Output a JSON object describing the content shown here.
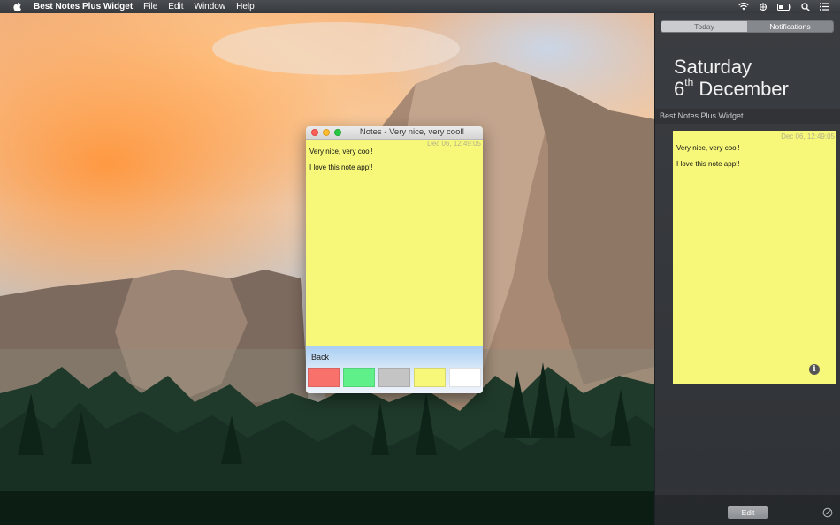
{
  "menubar": {
    "apple_icon": "apple-logo-icon",
    "app_name": "Best Notes Plus Widget",
    "menus": [
      "File",
      "Edit",
      "Window",
      "Help"
    ],
    "status_icons": [
      "wifi-icon",
      "network-icon",
      "battery-icon",
      "spotlight-search-icon",
      "notification-center-icon"
    ]
  },
  "note_window": {
    "title": "Notes - Very nice, very cool!",
    "date": "Dec 06, 12:49:05",
    "lines": [
      "Very nice, very cool!",
      "I love this note app!!"
    ],
    "back_label": "Back",
    "colors": [
      "#f8716b",
      "#5ff08a",
      "#c4c4c4",
      "#f7f87a",
      "#ffffff"
    ]
  },
  "notification_center": {
    "tabs": [
      "Today",
      "Notifications"
    ],
    "selected_tab": "Notifications",
    "day": "Saturday",
    "date_number": "6",
    "date_suffix": "th",
    "date_month": "December",
    "widget_title": "Best Notes Plus Widget",
    "widget_note": {
      "date": "Dec 06, 12:49:05",
      "lines": [
        "Very nice, very cool!",
        "I love this note app!!"
      ],
      "color": "#f7f87a"
    },
    "edit_label": "Edit"
  }
}
